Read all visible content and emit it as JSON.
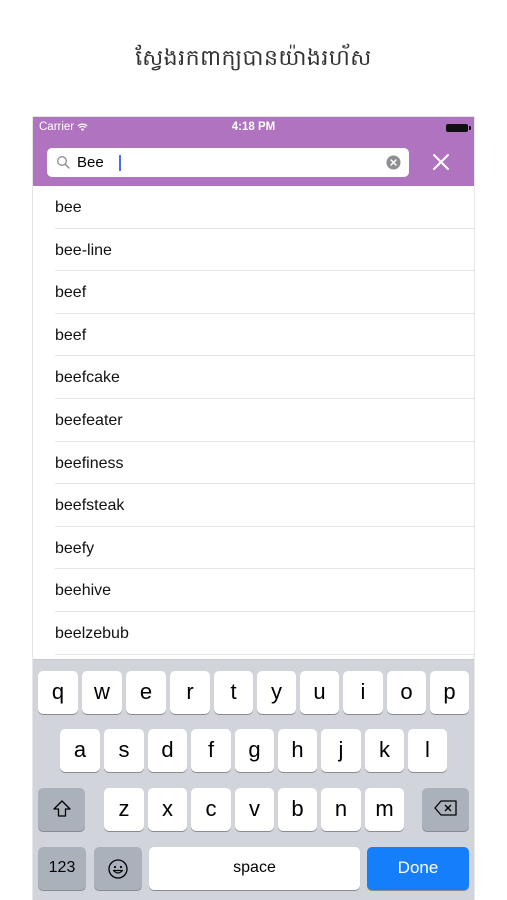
{
  "promo": {
    "title": "ស្វែងរកពាក្យបានយ៉ាងរហ័ស"
  },
  "status_bar": {
    "carrier": "Carrier",
    "time": "4:18 PM"
  },
  "search": {
    "value": "Bee",
    "placeholder": ""
  },
  "results": [
    "bee",
    "bee-line",
    "beef",
    "beef",
    "beefcake",
    "beefeater",
    "beefiness",
    "beefsteak",
    "beefy",
    "beehive",
    "beelzebub"
  ],
  "keyboard": {
    "row1": [
      "q",
      "w",
      "e",
      "r",
      "t",
      "y",
      "u",
      "i",
      "o",
      "p"
    ],
    "row2": [
      "a",
      "s",
      "d",
      "f",
      "g",
      "h",
      "j",
      "k",
      "l"
    ],
    "row3": [
      "z",
      "x",
      "c",
      "v",
      "b",
      "n",
      "m"
    ],
    "numbers_label": "123",
    "space_label": "space",
    "done_label": "Done"
  },
  "colors": {
    "header": "#b073bf",
    "done_key": "#157efb",
    "keyboard_bg": "#d1d4db"
  }
}
